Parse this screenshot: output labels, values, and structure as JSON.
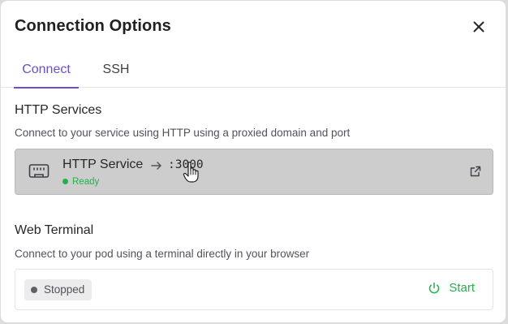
{
  "dialog": {
    "title": "Connection Options"
  },
  "tabs": [
    {
      "label": "Connect",
      "active": true
    },
    {
      "label": "SSH",
      "active": false
    }
  ],
  "http_section": {
    "title": "HTTP Services",
    "description": "Connect to your service using HTTP using a proxied domain and port",
    "service": {
      "name": "HTTP Service",
      "port": ":3000",
      "status": "Ready"
    }
  },
  "terminal_section": {
    "title": "Web Terminal",
    "description": "Connect to your pod using a terminal directly in your browser",
    "status": "Stopped",
    "start_label": "Start"
  },
  "colors": {
    "accent": "#6d4ec7",
    "success": "#22b14c",
    "stopped": "#5f6068"
  },
  "icons": {
    "close": "close-icon",
    "service": "ethernet-port-icon",
    "arrow": "arrow-right-icon",
    "external": "external-link-icon",
    "power": "power-icon",
    "cursor": "hand-pointer-cursor-icon"
  }
}
